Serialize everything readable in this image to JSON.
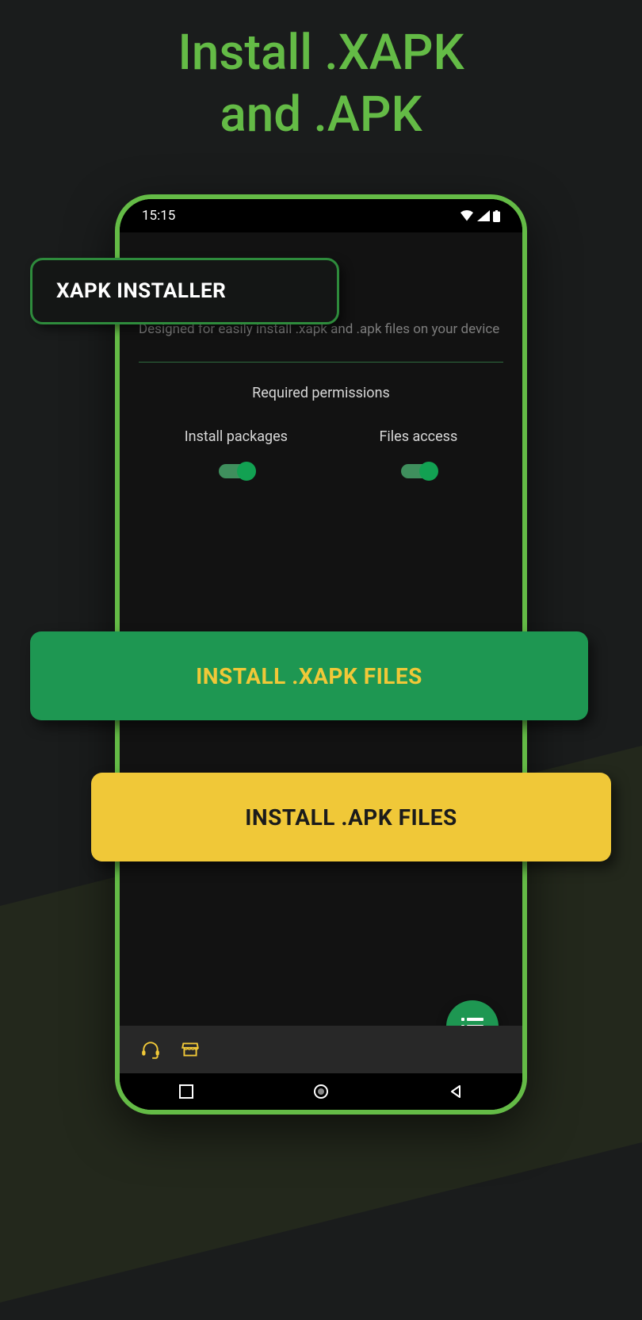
{
  "hero": {
    "line1": "Install .XAPK",
    "line2": "and .APK"
  },
  "overlay_pill_label": "XAPK INSTALLER",
  "status": {
    "time": "15:15"
  },
  "app": {
    "description": "Designed for easily install .xapk and .apk files on your device",
    "permissions_heading": "Required permissions",
    "perms": [
      {
        "label": "Install packages",
        "enabled": true
      },
      {
        "label": "Files access",
        "enabled": true
      }
    ]
  },
  "buttons": {
    "install_xapk": "INSTALL .XAPK FILES",
    "install_apk": "INSTALL .APK FILES"
  }
}
